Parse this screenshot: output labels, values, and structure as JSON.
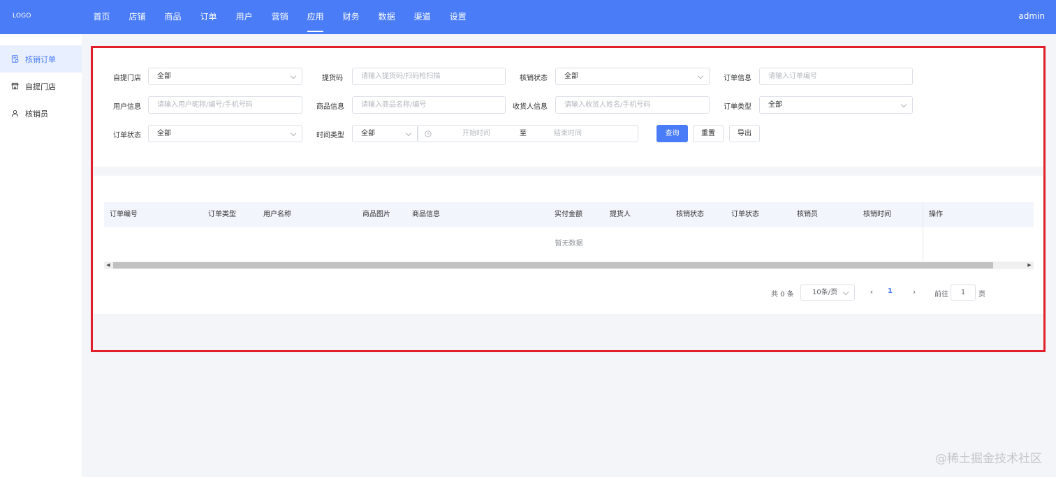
{
  "header": {
    "logo": "LOGO",
    "nav": [
      "首页",
      "店铺",
      "商品",
      "订单",
      "用户",
      "营销",
      "应用",
      "财务",
      "数据",
      "渠道",
      "设置"
    ],
    "active_nav": "应用",
    "user": "admin"
  },
  "sidebar": {
    "items": [
      {
        "label": "核销订单",
        "icon": "receipt-icon",
        "active": true
      },
      {
        "label": "自提门店",
        "icon": "store-icon",
        "active": false
      },
      {
        "label": "核销员",
        "icon": "user-icon",
        "active": false
      }
    ]
  },
  "filters": {
    "store_label": "自提门店",
    "store_value": "全部",
    "pickup_code_label": "提货码",
    "pickup_code_placeholder": "请输入提货码/扫码枪扫描",
    "verify_status_label": "核销状态",
    "verify_status_value": "全部",
    "order_info_label": "订单信息",
    "order_info_placeholder": "请输入订单编号",
    "user_info_label": "用户信息",
    "user_info_placeholder": "请输入用户昵称/编号/手机号码",
    "goods_info_label": "商品信息",
    "goods_info_placeholder": "请输入商品名称/编号",
    "receiver_label": "收货人信息",
    "receiver_placeholder": "请输入收货人姓名/手机号码",
    "order_type_label": "订单类型",
    "order_type_value": "全部",
    "order_status_label": "订单状态",
    "order_status_value": "全部",
    "time_type_label": "时间类型",
    "time_type_value": "全部",
    "start_placeholder": "开始时间",
    "range_separator": "至",
    "end_placeholder": "结束时间",
    "query_label": "查询",
    "reset_label": "重置",
    "export_label": "导出"
  },
  "table": {
    "columns": [
      "订单编号",
      "订单类型",
      "用户名称",
      "商品图片",
      "商品信息",
      "实付金额",
      "提货人",
      "核销状态",
      "订单状态",
      "核销员",
      "核销时间",
      "操作"
    ],
    "empty_text": "暂无数据"
  },
  "pagination": {
    "total": "共 0 条",
    "page_size": "10条/页",
    "current_page": "1",
    "goto_label": "前往",
    "goto_value": "1",
    "page_unit": "页"
  },
  "watermark": "@稀土掘金技术社区",
  "colors": {
    "primary": "#4a7cf7",
    "highlight_border": "#e01f2a"
  }
}
